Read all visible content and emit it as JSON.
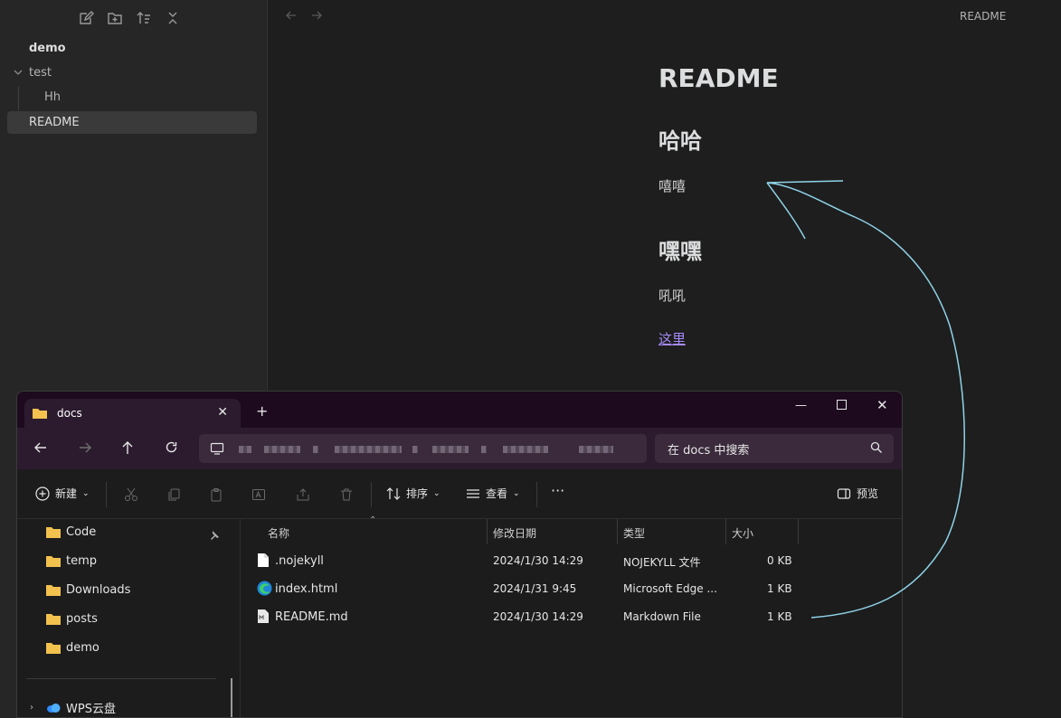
{
  "sidebar": {
    "vault_name": "demo",
    "folder": "test",
    "child": "Hh",
    "active_file": "README",
    "toolbar_icons": [
      "new-note-icon",
      "new-folder-icon",
      "sort-icon",
      "collapse-icon"
    ]
  },
  "main": {
    "tab_title": "README",
    "doc": {
      "h1": "README",
      "h2a": "哈哈",
      "pa": "嘻嘻",
      "h2b": "嘿嘿",
      "pb": "吼吼",
      "link": "这里"
    }
  },
  "explorer": {
    "tab_title": "docs",
    "search_placeholder": "在 docs 中搜索",
    "commands": {
      "new": "新建",
      "sort": "排序",
      "view": "查看",
      "more": "···",
      "preview": "预览"
    },
    "nav": [
      "Code",
      "temp",
      "Downloads",
      "posts",
      "demo"
    ],
    "wps": "WPS云盘",
    "columns": {
      "name": "名称",
      "date": "修改日期",
      "type": "类型",
      "size": "大小"
    },
    "files": [
      {
        "name": ".nojekyll",
        "date": "2024/1/30 14:29",
        "type": "NOJEKYLL 文件",
        "size": "0 KB"
      },
      {
        "name": "index.html",
        "date": "2024/1/31 9:45",
        "type": "Microsoft Edge ...",
        "size": "1 KB"
      },
      {
        "name": "README.md",
        "date": "2024/1/30 14:29",
        "type": "Markdown File",
        "size": "1 KB"
      }
    ]
  },
  "colors": {
    "accent_link": "#a88bfa",
    "annotation": "#8fd3e8",
    "folder": "#f2c14e"
  }
}
